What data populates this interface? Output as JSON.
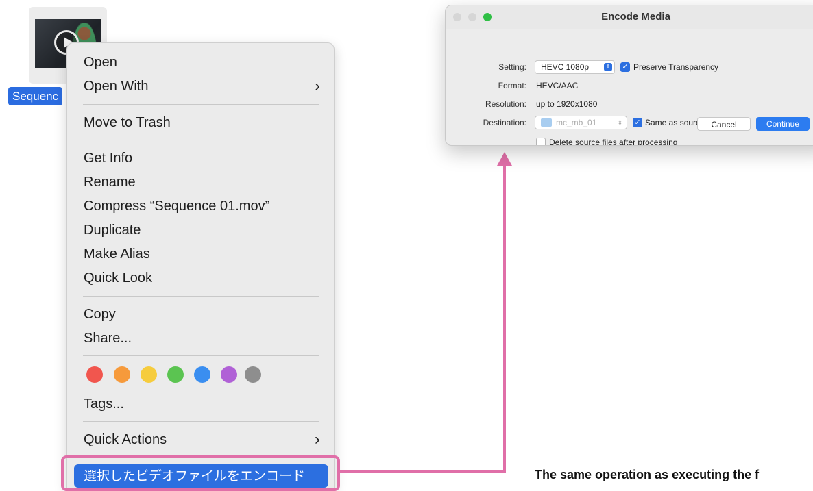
{
  "file": {
    "name": "Sequenc",
    "icon": "video-file-icon"
  },
  "context_menu": {
    "items": [
      {
        "label": "Open"
      },
      {
        "label": "Open With",
        "submenu": true
      },
      {
        "label": "Move to Trash"
      },
      {
        "label": "Get Info"
      },
      {
        "label": "Rename"
      },
      {
        "label": "Compress “Sequence 01.mov”"
      },
      {
        "label": "Duplicate"
      },
      {
        "label": "Make Alias"
      },
      {
        "label": "Quick Look"
      },
      {
        "label": "Copy"
      },
      {
        "label": "Share..."
      },
      {
        "label": "Tags..."
      },
      {
        "label": "Quick Actions",
        "submenu": true
      }
    ],
    "tag_colors": [
      "#f1564e",
      "#f69a3b",
      "#f6cc3d",
      "#5bc451",
      "#3a8ef0",
      "#b061d6",
      "#8e8e8e"
    ],
    "highlighted_item": "選択したビデオファイルをエンコード"
  },
  "window": {
    "title": "Encode Media",
    "setting_label": "Setting:",
    "setting_value": "HEVC 1080p",
    "preserve_transparency": "Preserve Transparency",
    "format_label": "Format:",
    "format_value": "HEVC/AAC",
    "resolution_label": "Resolution:",
    "resolution_value": "up to 1920x1080",
    "destination_label": "Destination:",
    "destination_value": "mc_mb_01",
    "same_as_source": "Same as source file",
    "delete_source": "Delete source files after processing",
    "cancel_label": "Cancel",
    "continue_label": "Continue"
  },
  "colors": {
    "accent": "#2c6fe0",
    "annotation": "#e06fa8"
  },
  "caption": "The same operation as executing the f"
}
